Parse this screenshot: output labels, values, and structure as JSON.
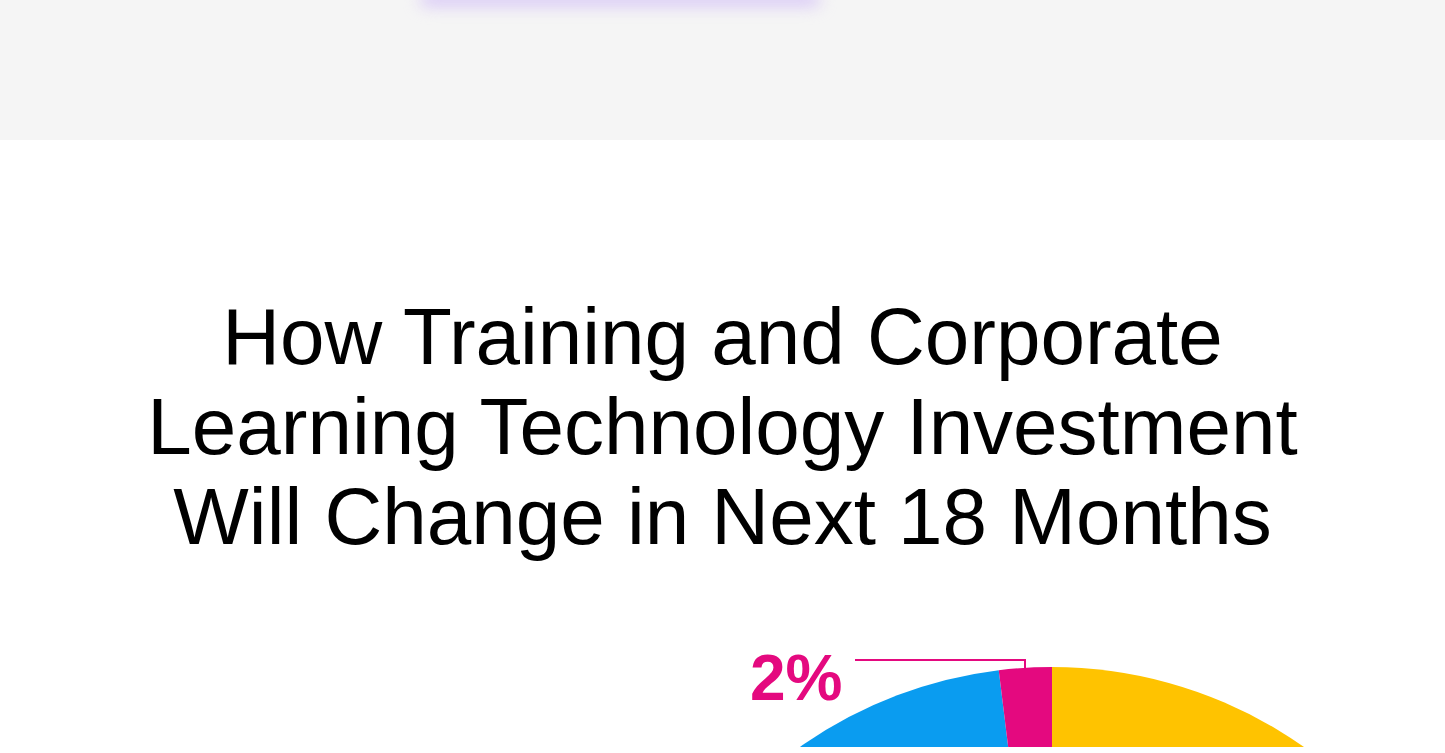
{
  "heading": "How Training and Corporate Learning Technology Investment Will Change in Next 18 Months",
  "chart": {
    "callout": "2%",
    "slices": [
      {
        "color": "#0a9cf0"
      },
      {
        "color": "#e4097f"
      },
      {
        "color": "#ffc300"
      }
    ]
  }
}
